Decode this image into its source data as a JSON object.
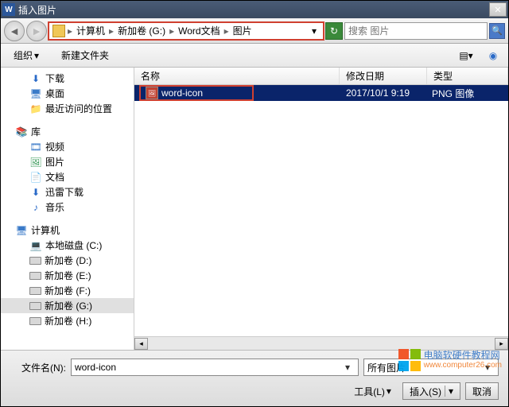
{
  "title": "插入图片",
  "breadcrumb": {
    "segments": [
      "计算机",
      "新加卷 (G:)",
      "Word文档",
      "图片"
    ]
  },
  "search": {
    "placeholder": "搜索 图片"
  },
  "toolbar": {
    "organize": "组织",
    "newfolder": "新建文件夹"
  },
  "tree": {
    "group1": [
      {
        "label": "下载",
        "icon": "folder"
      },
      {
        "label": "桌面",
        "icon": "desktop"
      },
      {
        "label": "最近访问的位置",
        "icon": "recent"
      }
    ],
    "lib_label": "库",
    "group2": [
      {
        "label": "视频",
        "icon": "video"
      },
      {
        "label": "图片",
        "icon": "image"
      },
      {
        "label": "文档",
        "icon": "doc"
      },
      {
        "label": "迅雷下载",
        "icon": "xl"
      },
      {
        "label": "音乐",
        "icon": "music"
      }
    ],
    "computer_label": "计算机",
    "group3": [
      {
        "label": "本地磁盘 (C:)",
        "icon": "sysdrive"
      },
      {
        "label": "新加卷 (D:)",
        "icon": "drive"
      },
      {
        "label": "新加卷 (E:)",
        "icon": "drive"
      },
      {
        "label": "新加卷 (F:)",
        "icon": "drive"
      },
      {
        "label": "新加卷 (G:)",
        "icon": "drive",
        "sel": true
      },
      {
        "label": "新加卷 (H:)",
        "icon": "drive"
      }
    ]
  },
  "list": {
    "headers": {
      "name": "名称",
      "date": "修改日期",
      "type": "类型"
    },
    "rows": [
      {
        "name": "word-icon",
        "date": "2017/10/1 9:19",
        "type": "PNG 图像",
        "sel": true
      }
    ]
  },
  "footer": {
    "filename_label": "文件名(N):",
    "filename_value": "word-icon",
    "filter": "所有图片",
    "tools": "工具(L)",
    "insert": "插入(S)",
    "cancel": "取消"
  },
  "watermark": {
    "line1": "电脑软硬件教程网",
    "line2": "www.computer26.com"
  }
}
